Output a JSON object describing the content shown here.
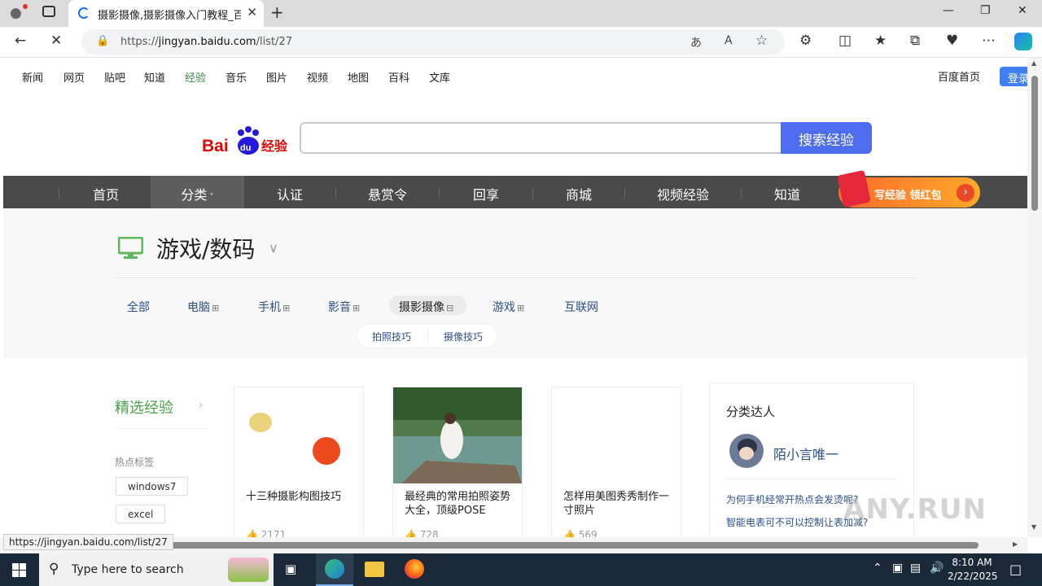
{
  "browser": {
    "tab_title": "摄影摄像,摄影摄像入门教程_百度",
    "url_prefix": "https://",
    "url_host": "jingyan.baidu.com",
    "url_path": "/list/27",
    "status_url": "https://jingyan.baidu.com/list/27"
  },
  "topnav": {
    "items": [
      "新闻",
      "网页",
      "贴吧",
      "知道",
      "经验",
      "音乐",
      "图片",
      "视频",
      "地图",
      "百科",
      "文库"
    ],
    "home": "百度首页",
    "login": "登录"
  },
  "search": {
    "button": "搜索经验"
  },
  "catnav": {
    "items": [
      "首页",
      "分类",
      "认证",
      "悬赏令",
      "回享",
      "商城",
      "视频经验",
      "知道"
    ],
    "promo": "写经验 领红包"
  },
  "category": {
    "title": "游戏/数码",
    "subcats": [
      "全部",
      "电脑",
      "手机",
      "影音",
      "摄影摄像",
      "游戏",
      "互联网"
    ],
    "subsubs": [
      "拍照技巧",
      "摄像技巧"
    ]
  },
  "sidebar": {
    "title": "精选经验",
    "hot_label": "热点标签",
    "tags": [
      "windows7",
      "excel"
    ]
  },
  "cards": [
    {
      "title": "十三种摄影构图技巧",
      "likes": "2171"
    },
    {
      "title": "最经典的常用拍照姿势大全，顶级POSE",
      "likes": "728"
    },
    {
      "title": "怎样用美图秀秀制作一寸照片",
      "likes": "569"
    }
  ],
  "right_panel": {
    "title": "分类达人",
    "user": "陌小言唯一",
    "questions": [
      "为何手机经常开热点会发烫呢?",
      "智能电表可不可以控制让表加减?"
    ]
  },
  "taskbar": {
    "search_placeholder": "Type here to search",
    "time": "8:10 AM",
    "date": "2/22/2025"
  },
  "watermark": "ANY.RUN",
  "colors": {
    "accent_green": "#4aa34a",
    "link_blue": "#2b4f8c",
    "search_blue": "#4e6ef2"
  }
}
